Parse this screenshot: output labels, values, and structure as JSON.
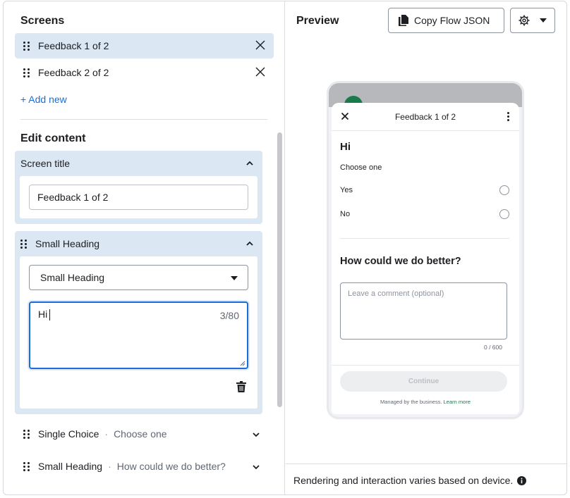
{
  "left": {
    "screens_title": "Screens",
    "screens": [
      {
        "label": "Feedback 1 of 2",
        "selected": true
      },
      {
        "label": "Feedback 2 of 2",
        "selected": false
      }
    ],
    "add_new": "+ Add new",
    "edit_title": "Edit content",
    "screen_title_card": {
      "header": "Screen title",
      "value": "Feedback 1 of 2"
    },
    "small_heading_card": {
      "header": "Small Heading",
      "select_value": "Small Heading",
      "text_value": "Hi",
      "counter": "3/80"
    },
    "collapsed": [
      {
        "label": "Single Choice",
        "sub": "Choose one"
      },
      {
        "label": "Small Heading",
        "sub": "How could we do better?"
      }
    ],
    "separator": "·"
  },
  "right": {
    "title": "Preview",
    "copy_button": "Copy Flow JSON",
    "gear_icon": "gear-icon",
    "preview": {
      "header_title": "Feedback 1 of 2",
      "heading": "Hi",
      "label": "Choose one",
      "options": [
        "Yes",
        "No"
      ],
      "heading2": "How could we do better?",
      "comment_placeholder": "Leave a comment (optional)",
      "comment_count": "0 / 600",
      "continue": "Continue",
      "managed_text": "Managed by the business.",
      "learn_more": "Learn more"
    },
    "footer_text": "Rendering and interaction varies based on device."
  },
  "colors": {
    "selected_bg": "#dbe7f3",
    "link": "#1a6ed8",
    "focus_border": "#1a6ed8",
    "brand_green": "#1a7a4c"
  }
}
